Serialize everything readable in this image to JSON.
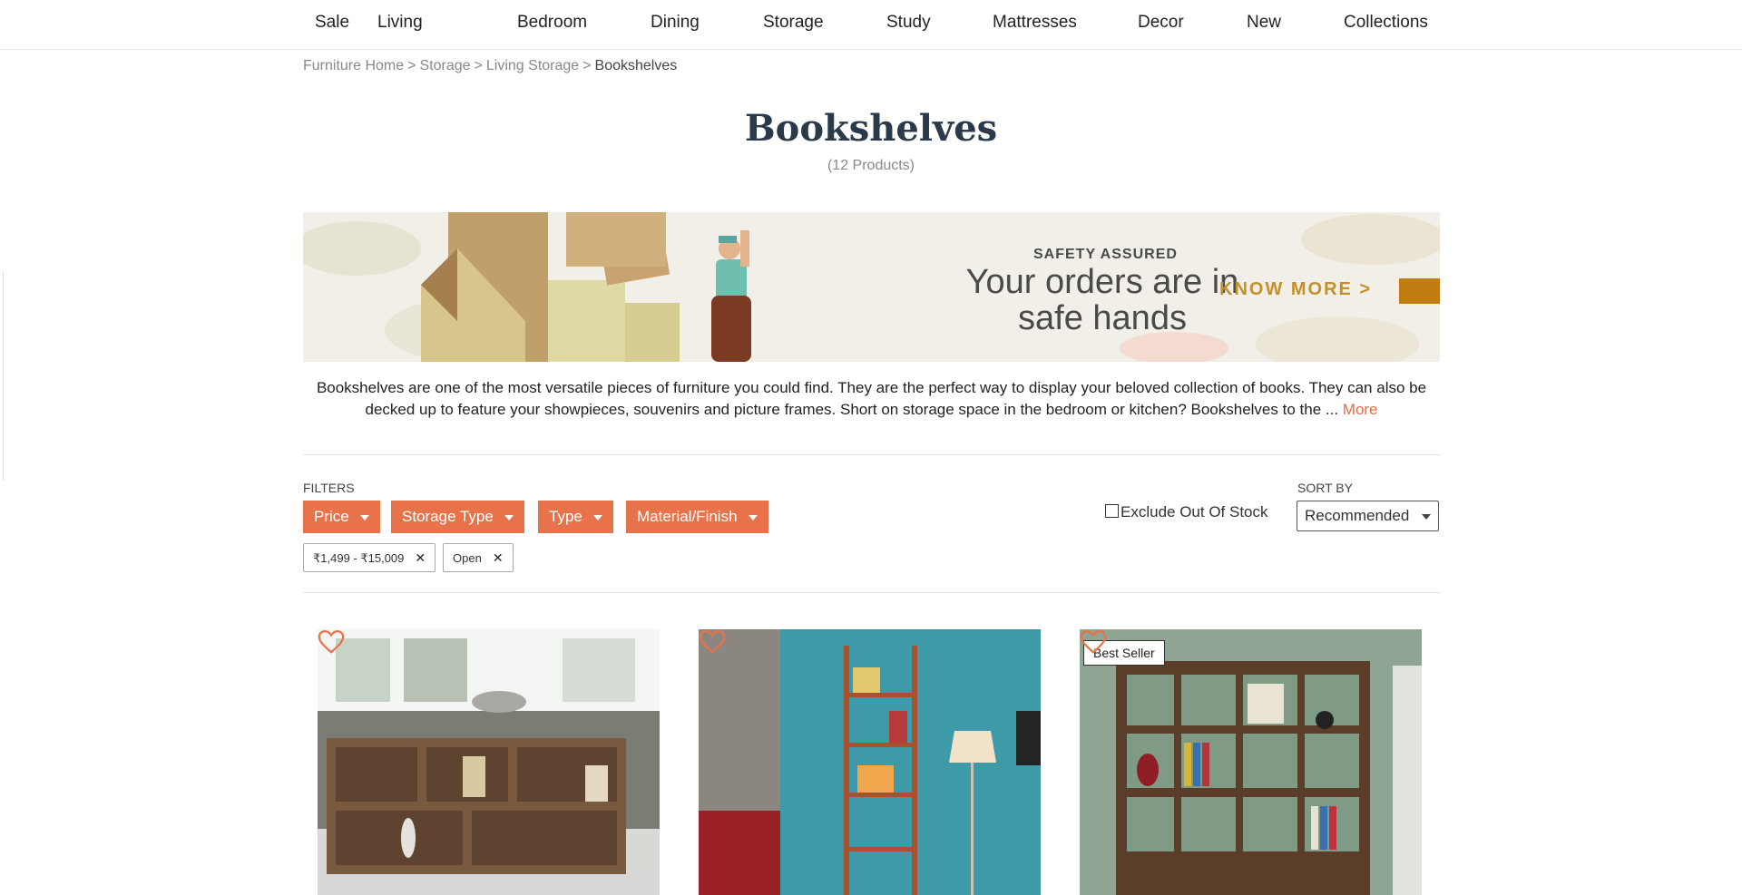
{
  "nav": {
    "items": [
      "Sale",
      "Living",
      "Bedroom",
      "Dining",
      "Storage",
      "Study",
      "Mattresses",
      "Decor",
      "New",
      "Collections"
    ]
  },
  "breadcrumb": {
    "items": [
      "Furniture Home",
      "Storage",
      "Living Storage"
    ],
    "separator": ">",
    "current": "Bookshelves"
  },
  "page": {
    "title": "Bookshelves",
    "count": "(12 Products)"
  },
  "banner": {
    "kicker": "SAFETY ASSURED",
    "headline_line1": "Your orders are in",
    "headline_line2": "safe hands",
    "cta": "KNOW MORE >"
  },
  "description": {
    "text": "Bookshelves are one of the most versatile pieces of furniture you could find. They are the perfect way to display your beloved collection of books. They can also be decked up to feature your showpieces, souvenirs and picture frames. Short on storage space in the bedroom or kitchen? Bookshelves to the ...",
    "more_label": "More"
  },
  "filters": {
    "label": "FILTERS",
    "buttons": [
      "Price",
      "Storage Type",
      "Type",
      "Material/Finish"
    ],
    "applied": [
      "₹1,499 - ₹15,009",
      "Open"
    ],
    "remove_glyph": "✕",
    "exclude_out_of_stock": {
      "label": "Exclude Out Of Stock",
      "checked": false
    }
  },
  "sort": {
    "label": "SORT BY",
    "selected": "Recommended"
  },
  "products": [
    {
      "badge": "",
      "wishlisted": false
    },
    {
      "badge": "",
      "wishlisted": false
    },
    {
      "badge": "Best Seller",
      "wishlisted": false
    }
  ],
  "colors": {
    "accent": "#e8734a",
    "banner_bg": "#f1efe7",
    "banner_cta": "#c5902a",
    "title": "#2b3a4a"
  },
  "icons": {
    "heart": "heart-outline-icon",
    "caret": "caret-down-icon",
    "remove": "close-icon",
    "checkbox": "checkbox-icon"
  }
}
